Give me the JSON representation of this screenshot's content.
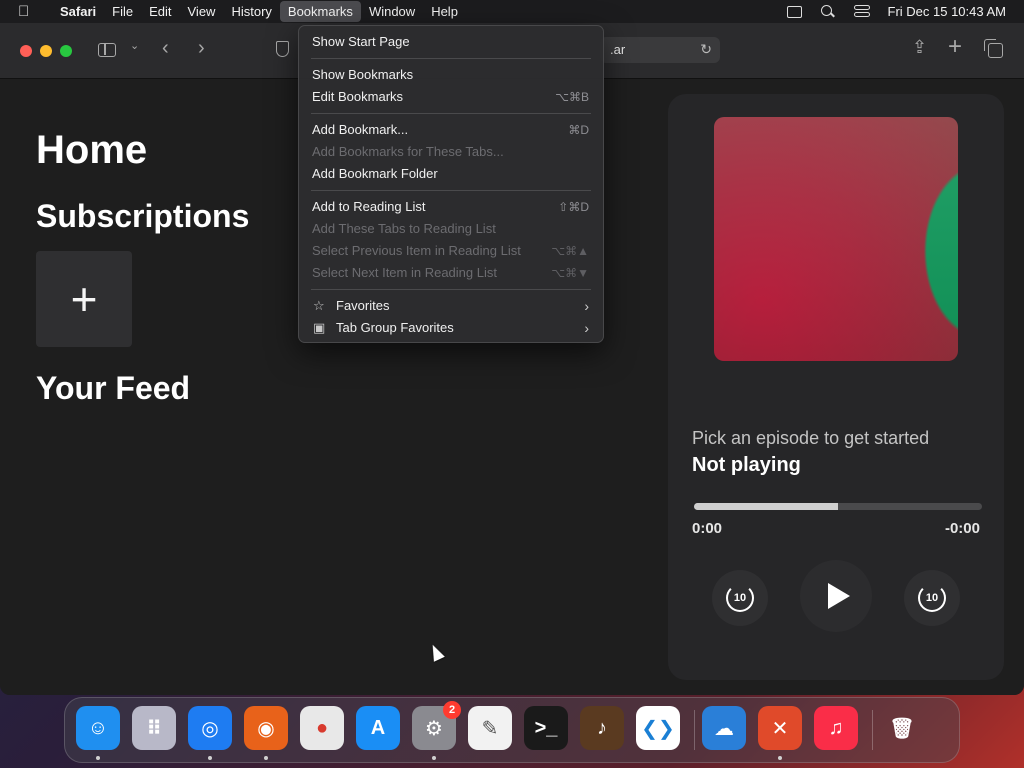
{
  "menubar": {
    "apple_icon": "apple-logo-icon",
    "app_name": "Safari",
    "items": [
      "File",
      "Edit",
      "View",
      "History",
      "Bookmarks",
      "Window",
      "Help"
    ],
    "active_item": "Bookmarks",
    "status_icons": [
      "screen-mirroring-icon",
      "spotlight-search-icon",
      "control-center-icon"
    ],
    "clock": "Fri Dec 15  10:43 AM"
  },
  "toolbar": {
    "url_text": ".ar",
    "reload_glyph": "↻",
    "back_glyph": "‹",
    "forward_glyph": "›",
    "tab_menu_glyph": "⌄",
    "share_glyph": "⇪",
    "new_tab_glyph": "+"
  },
  "page": {
    "home_title": "Home",
    "subscriptions_title": "Subscriptions",
    "add_subscription_glyph": "+",
    "feed_title": "Your Feed"
  },
  "player": {
    "subtitle": "Pick an episode to get started",
    "title": "Not playing",
    "progress": 0.5,
    "time_elapsed": "0:00",
    "time_remaining": "-0:00",
    "skip_back_label": "10",
    "skip_forward_label": "10",
    "artwork_colors": [
      "#c01c3c",
      "#8a3a3e",
      "#119a5c"
    ]
  },
  "bookmarks_menu": {
    "groups": [
      [
        {
          "label": "Show Start Page",
          "shortcut": "",
          "enabled": true
        }
      ],
      [
        {
          "label": "Show Bookmarks",
          "shortcut": "",
          "enabled": true
        },
        {
          "label": "Edit Bookmarks",
          "shortcut": "⌥⌘B",
          "enabled": true
        }
      ],
      [
        {
          "label": "Add Bookmark...",
          "shortcut": "⌘D",
          "enabled": true
        },
        {
          "label": "Add Bookmarks for These Tabs...",
          "shortcut": "",
          "enabled": false
        },
        {
          "label": "Add Bookmark Folder",
          "shortcut": "",
          "enabled": true
        }
      ],
      [
        {
          "label": "Add to Reading List",
          "shortcut": "⇧⌘D",
          "enabled": true
        },
        {
          "label": "Add These Tabs to Reading List",
          "shortcut": "",
          "enabled": false
        },
        {
          "label": "Select Previous Item in Reading List",
          "shortcut": "⌥⌘▲",
          "enabled": false
        },
        {
          "label": "Select Next Item in Reading List",
          "shortcut": "⌥⌘▼",
          "enabled": false
        }
      ],
      [
        {
          "label": "Favorites",
          "icon": "star-icon",
          "submenu": true,
          "enabled": true
        },
        {
          "label": "Tab Group Favorites",
          "icon": "tab-group-icon",
          "submenu": true,
          "enabled": true
        }
      ]
    ]
  },
  "dock": {
    "apps": [
      {
        "name": "Finder",
        "icon": "finder-icon",
        "color": "#1f8ff0",
        "running": true
      },
      {
        "name": "Launchpad",
        "icon": "launchpad-icon",
        "color": "#b8b8c8",
        "running": false
      },
      {
        "name": "Safari",
        "icon": "safari-icon",
        "color": "#1e7cf2",
        "running": true
      },
      {
        "name": "Firefox",
        "icon": "firefox-icon",
        "color": "#e8621a",
        "running": true
      },
      {
        "name": "Chrome",
        "icon": "chrome-icon",
        "color": "#e8e8e8",
        "running": false
      },
      {
        "name": "App Store",
        "icon": "app-store-icon",
        "color": "#1a8ef5",
        "running": false
      },
      {
        "name": "System Settings",
        "icon": "system-settings-icon",
        "color": "#8a8a90",
        "running": true,
        "badge": "2"
      },
      {
        "name": "TextEdit",
        "icon": "textedit-icon",
        "color": "#f2f2f2",
        "running": false
      },
      {
        "name": "Terminal",
        "icon": "terminal-icon",
        "color": "#1a1a1a",
        "running": false
      },
      {
        "name": "GarageBand",
        "icon": "garageband-icon",
        "color": "#5a3a20",
        "running": false
      },
      {
        "name": "Visual Studio Code",
        "icon": "vscode-icon",
        "color": "#ffffff",
        "running": false
      },
      {
        "name": "Weather",
        "icon": "weather-icon",
        "color": "#2a7fd8",
        "running": false
      },
      {
        "name": "Remote Desktop",
        "icon": "remote-desktop-icon",
        "color": "#e04a2a",
        "running": true
      },
      {
        "name": "Music",
        "icon": "music-icon",
        "color": "#fa2d48",
        "running": false
      },
      {
        "name": "Trash",
        "icon": "trash-icon",
        "color": "#7a7a80",
        "running": false
      }
    ]
  }
}
